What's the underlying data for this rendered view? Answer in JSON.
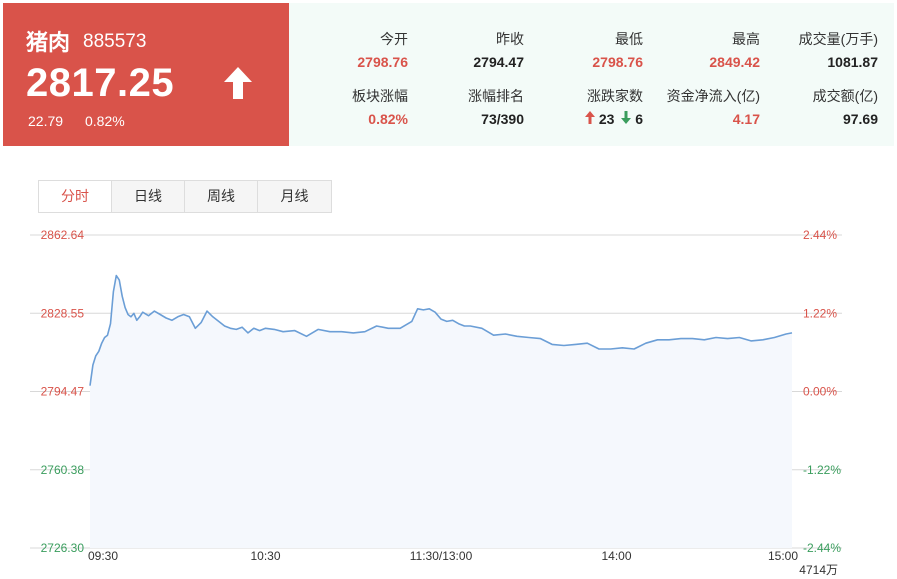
{
  "quote": {
    "name": "猪肉",
    "code": "885573",
    "price": "2817.25",
    "change": "22.79",
    "change_pct": "0.82%",
    "direction_icon": "up-arrow-icon"
  },
  "stats": [
    {
      "label": "今开",
      "value": "2798.76",
      "color": "red"
    },
    {
      "label": "昨收",
      "value": "2794.47",
      "color": "dark"
    },
    {
      "label": "最低",
      "value": "2798.76",
      "color": "red"
    },
    {
      "label": "最高",
      "value": "2849.42",
      "color": "red"
    },
    {
      "label": "成交量(万手)",
      "value": "1081.87",
      "color": "dark"
    },
    {
      "label": "板块涨幅",
      "value": "0.82%",
      "color": "red"
    },
    {
      "label": "涨幅排名",
      "value": "73/390",
      "color": "dark"
    },
    {
      "label": "涨跌家数",
      "up": "23",
      "down": "6"
    },
    {
      "label": "资金净流入(亿)",
      "value": "4.17",
      "color": "red"
    },
    {
      "label": "成交额(亿)",
      "value": "97.69",
      "color": "dark"
    }
  ],
  "tabs": [
    "分时",
    "日线",
    "周线",
    "月线"
  ],
  "active_tab": "分时",
  "colors": {
    "red": "#d9534a",
    "green": "#3a9d5d",
    "line": "#6b9ed6",
    "fill": "#f5f8fd"
  },
  "chart_data": {
    "type": "line",
    "title": "",
    "xlabel": "",
    "ylabel": "",
    "ylim": [
      2726.3,
      2862.64
    ],
    "prev_close": 2794.47,
    "y_tick_labels": [
      "2862.64",
      "2828.55",
      "2794.47",
      "2760.38",
      "2726.30"
    ],
    "y_tick_values": [
      2862.64,
      2828.55,
      2794.47,
      2760.38,
      2726.3
    ],
    "right_tick_labels": [
      "2.44%",
      "1.22%",
      "0.00%",
      "-1.22%",
      "-2.44%"
    ],
    "x_tick_labels": [
      "09:30",
      "10:30",
      "11:30/13:00",
      "14:00",
      "15:00"
    ],
    "x_tick_minutes": [
      0,
      60,
      120,
      180,
      240
    ],
    "volume_label": "4714万",
    "grid": true,
    "series": [
      {
        "x": [
          0,
          1,
          2,
          3,
          4,
          5,
          6,
          7,
          8,
          9,
          10,
          11,
          12,
          13,
          14,
          15,
          16,
          17,
          18,
          20,
          22,
          24,
          26,
          28,
          30,
          32,
          34,
          36,
          38,
          40,
          42,
          44,
          46,
          48,
          50,
          52,
          54,
          56,
          58,
          60,
          63,
          66,
          70,
          74,
          78,
          82,
          86,
          90,
          94,
          98,
          102,
          106,
          110,
          112,
          114,
          116,
          118,
          120,
          122,
          124,
          126,
          128,
          130,
          134,
          138,
          142,
          146,
          150,
          154,
          158,
          162,
          166,
          170,
          174,
          178,
          182,
          186,
          190,
          194,
          198,
          202,
          206,
          210,
          214,
          218,
          222,
          226,
          230,
          234,
          238,
          240
        ],
        "values": [
          2797.0,
          2806.0,
          2810.0,
          2812.0,
          2815.5,
          2818.0,
          2819.0,
          2824.0,
          2838.0,
          2845.0,
          2843.0,
          2836.0,
          2831.0,
          2828.0,
          2827.0,
          2828.5,
          2825.5,
          2827.0,
          2829.0,
          2827.5,
          2829.5,
          2828.0,
          2826.5,
          2825.5,
          2827.0,
          2828.0,
          2827.0,
          2822.0,
          2824.5,
          2829.5,
          2827.0,
          2825.0,
          2823.0,
          2822.0,
          2821.5,
          2822.5,
          2820.0,
          2822.0,
          2821.0,
          2822.0,
          2821.5,
          2820.5,
          2821.0,
          2818.5,
          2821.5,
          2820.5,
          2820.5,
          2820.0,
          2820.5,
          2823.0,
          2822.0,
          2822.0,
          2825.0,
          2830.5,
          2830.0,
          2830.5,
          2829.0,
          2826.0,
          2825.0,
          2825.5,
          2824.0,
          2823.0,
          2823.0,
          2822.0,
          2819.0,
          2819.5,
          2818.5,
          2818.0,
          2817.5,
          2815.0,
          2814.5,
          2815.0,
          2815.5,
          2813.0,
          2813.0,
          2813.5,
          2813.0,
          2815.5,
          2817.0,
          2817.0,
          2817.5,
          2817.5,
          2817.0,
          2818.0,
          2817.5,
          2818.0,
          2816.5,
          2817.0,
          2818.0,
          2819.5,
          2820.0
        ]
      }
    ]
  }
}
